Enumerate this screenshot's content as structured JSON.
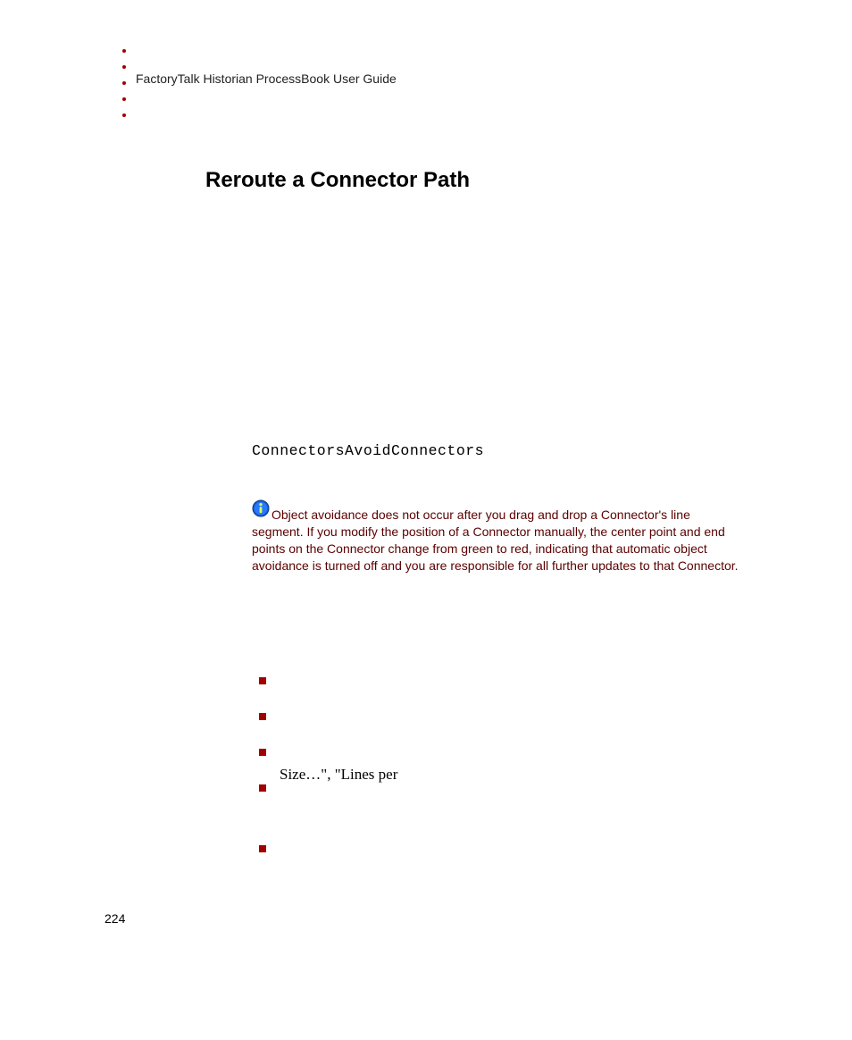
{
  "header": {
    "running_title": "FactoryTalk Historian ProcessBook User Guide"
  },
  "section": {
    "heading": "Reroute a Connector Path"
  },
  "code_property": "ConnectorsAvoidConnectors",
  "note": {
    "text": "Object avoidance does not occur after you drag and drop a Connector's line segment. If you modify the position of a Connector manually, the center point and end points on the Connector change from green to red, indicating that automatic object avoidance is turned off and you are responsible for all further updates to that Connector."
  },
  "fragment_text": "Size…\", \"Lines per",
  "page_number": "224"
}
